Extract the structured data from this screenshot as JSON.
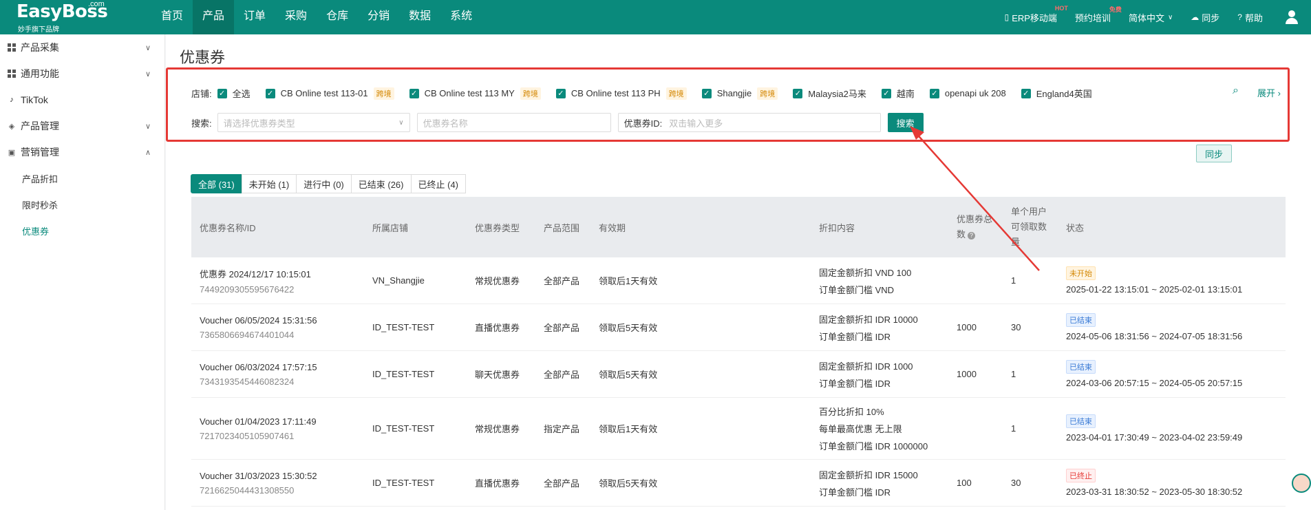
{
  "header": {
    "logo": "EasyBoss",
    "logo_com": ".com",
    "logo_sub": "妙手旗下品牌",
    "nav": [
      "首页",
      "产品",
      "订单",
      "采购",
      "仓库",
      "分销",
      "数据",
      "系统"
    ],
    "erp_mobile": "ERP移动端",
    "erp_tag": "HOT",
    "training": "预约培训",
    "training_tag": "免费",
    "language": "简体中文",
    "sync": "同步",
    "help": "帮助"
  },
  "sidebar": {
    "items": [
      {
        "label": "产品采集",
        "icon": "grid-icon",
        "chevron": "∨"
      },
      {
        "label": "通用功能",
        "icon": "grid-icon",
        "chevron": "∨"
      },
      {
        "label": "TikTok",
        "icon": "tiktok-icon"
      },
      {
        "label": "产品管理",
        "icon": "box-icon",
        "chevron": "∨"
      },
      {
        "label": "营销管理",
        "icon": "megaphone-icon",
        "chevron": "∧"
      }
    ],
    "sub_items": [
      "产品折扣",
      "限时秒杀",
      "优惠券"
    ]
  },
  "main": {
    "title": "优惠券",
    "filter": {
      "store_label": "店铺:",
      "select_all": "全选",
      "stores": [
        {
          "name": "CB Online test 113-01",
          "tag": "跨境"
        },
        {
          "name": "CB Online test 113 MY",
          "tag": "跨境"
        },
        {
          "name": "CB Online test 113 PH",
          "tag": "跨境"
        },
        {
          "name": "Shangjie",
          "tag": "跨境"
        },
        {
          "name": "Malaysia2马来",
          "tag": ""
        },
        {
          "name": "越南",
          "tag": ""
        },
        {
          "name": "openapi uk 208",
          "tag": ""
        },
        {
          "name": "England4英国",
          "tag": ""
        }
      ],
      "expand": "展开",
      "search_label": "搜索:",
      "type_placeholder": "请选择优惠券类型",
      "name_placeholder": "优惠券名称",
      "id_label": "优惠券ID:",
      "id_placeholder": "双击输入更多",
      "search_button": "搜索"
    },
    "sync_button": "同步",
    "tabs": [
      "全部 (31)",
      "未开始 (1)",
      "进行中 (0)",
      "已结束 (26)",
      "已终止 (4)"
    ],
    "table": {
      "headers": {
        "name": "优惠券名称/ID",
        "store": "所属店铺",
        "type": "优惠券类型",
        "scope": "产品范围",
        "validity": "有效期",
        "discount": "折扣内容",
        "total_1": "优惠券总",
        "total_2": "数",
        "per_user_1": "单个用户",
        "per_user_2": "可领取数",
        "per_user_3": "量",
        "status": "状态"
      },
      "rows": [
        {
          "name": "优惠券 2024/12/17 10:15:01",
          "id": "7449209305595676422",
          "store": "VN_Shangjie",
          "type": "常规优惠券",
          "scope": "全部产品",
          "validity": "领取后1天有效",
          "discount": [
            "固定金额折扣 VND 100",
            "订单金额门槛 VND"
          ],
          "total": "",
          "per_user": "1",
          "status": "未开始",
          "status_kind": "notstart",
          "period": "2025-01-22 13:15:01 ~ 2025-02-01 13:15:01"
        },
        {
          "name": "Voucher 06/05/2024 15:31:56",
          "id": "7365806694674401044",
          "store": "ID_TEST-TEST",
          "type": "直播优惠券",
          "scope": "全部产品",
          "validity": "领取后5天有效",
          "discount": [
            "固定金额折扣 IDR 10000",
            "订单金额门槛 IDR"
          ],
          "total": "1000",
          "per_user": "30",
          "status": "已结束",
          "status_kind": "ended",
          "period": "2024-05-06 18:31:56 ~ 2024-07-05 18:31:56"
        },
        {
          "name": "Voucher 06/03/2024 17:57:15",
          "id": "7343193545446082324",
          "store": "ID_TEST-TEST",
          "type": "聊天优惠券",
          "scope": "全部产品",
          "validity": "领取后5天有效",
          "discount": [
            "固定金额折扣 IDR 1000",
            "订单金额门槛 IDR"
          ],
          "total": "1000",
          "per_user": "1",
          "status": "已结束",
          "status_kind": "ended",
          "period": "2024-03-06 20:57:15 ~ 2024-05-05 20:57:15"
        },
        {
          "name": "Voucher 01/04/2023 17:11:49",
          "id": "7217023405105907461",
          "store": "ID_TEST-TEST",
          "type": "常规优惠券",
          "scope": "指定产品",
          "validity": "领取后1天有效",
          "discount": [
            "百分比折扣 10%",
            "每单最高优惠 无上限",
            "订单金额门槛 IDR 1000000"
          ],
          "total": "",
          "per_user": "1",
          "status": "已结束",
          "status_kind": "ended",
          "period": "2023-04-01 17:30:49 ~ 2023-04-02 23:59:49"
        },
        {
          "name": "Voucher 31/03/2023 15:30:52",
          "id": "7216625044431308550",
          "store": "ID_TEST-TEST",
          "type": "直播优惠券",
          "scope": "全部产品",
          "validity": "领取后5天有效",
          "discount": [
            "固定金额折扣 IDR 15000",
            "订单金额门槛 IDR"
          ],
          "total": "100",
          "per_user": "30",
          "status": "已终止",
          "status_kind": "stopped",
          "period": "2023-03-31 18:30:52 ~ 2023-05-30 18:30:52"
        }
      ]
    }
  },
  "colors": {
    "brand": "#0a8a7c",
    "highlight": "#e53935"
  }
}
